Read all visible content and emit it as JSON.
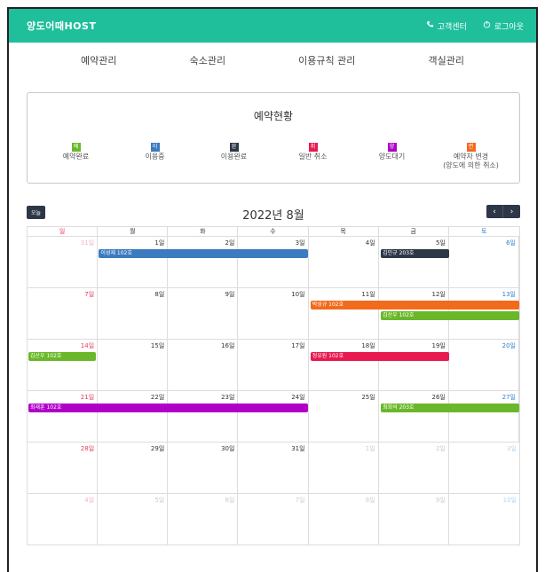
{
  "header": {
    "logo": "양도어때HOST",
    "support": "고객센터",
    "logout": "로그아웃"
  },
  "nav": [
    "예약관리",
    "숙소관리",
    "이용규칙 관리",
    "객실관리"
  ],
  "status": {
    "title": "예약현황",
    "legend": [
      {
        "badge": "예",
        "label": "예약완료",
        "color": "#6ab82a"
      },
      {
        "badge": "이",
        "label": "이용중",
        "color": "#3b7bbf"
      },
      {
        "badge": "완",
        "label": "이용완료",
        "color": "#2d3748"
      },
      {
        "badge": "취",
        "label": "일반 취소",
        "color": "#e8194f"
      },
      {
        "badge": "양",
        "label": "양도대기",
        "color": "#b000c8"
      },
      {
        "badge": "변",
        "label": "예약자 변경\n(양도에 의한 취소)",
        "color": "#f26a1b"
      }
    ]
  },
  "calendar": {
    "today_label": "오늘",
    "title": "2022년 8월",
    "prev": "‹",
    "next": "›",
    "weekdays": [
      "일",
      "월",
      "화",
      "수",
      "목",
      "금",
      "토"
    ],
    "weeks": [
      {
        "days": [
          "31일",
          "1일",
          "2일",
          "3일",
          "4일",
          "5일",
          "6일"
        ],
        "other": [
          0
        ],
        "events": [
          {
            "label": "이성재 102호",
            "start": 1,
            "span": 3,
            "row": 0,
            "color": "#3b7bbf"
          },
          {
            "label": "김민규 203호",
            "start": 5,
            "span": 1,
            "row": 0,
            "color": "#2d3748"
          }
        ]
      },
      {
        "days": [
          "7일",
          "8일",
          "9일",
          "10일",
          "11일",
          "12일",
          "13일"
        ],
        "other": [],
        "events": [
          {
            "label": "박성규 102호",
            "start": 4,
            "span": 3,
            "row": 0,
            "color": "#f26a1b"
          },
          {
            "label": "김산우 102호",
            "start": 5,
            "span": 2,
            "row": 1,
            "color": "#6ab82a"
          }
        ]
      },
      {
        "days": [
          "14일",
          "15일",
          "16일",
          "17일",
          "18일",
          "19일",
          "20일"
        ],
        "other": [],
        "events": [
          {
            "label": "김산우 102호",
            "start": 0,
            "span": 1,
            "row": 0,
            "color": "#6ab82a"
          },
          {
            "label": "정유원 102호",
            "start": 4,
            "span": 2,
            "row": 0,
            "color": "#e8194f"
          }
        ]
      },
      {
        "days": [
          "21일",
          "22일",
          "23일",
          "24일",
          "25일",
          "26일",
          "27일"
        ],
        "other": [],
        "events": [
          {
            "label": "최재훈 102호",
            "start": 0,
            "span": 4,
            "row": 0,
            "color": "#b000c8"
          },
          {
            "label": "최희석 203호",
            "start": 5,
            "span": 2,
            "row": 0,
            "color": "#6ab82a"
          }
        ]
      },
      {
        "days": [
          "28일",
          "29일",
          "30일",
          "31일",
          "1일",
          "2일",
          "3일"
        ],
        "other": [
          4,
          5,
          6
        ],
        "events": []
      },
      {
        "days": [
          "4일",
          "5일",
          "6일",
          "7일",
          "8일",
          "9일",
          "10일"
        ],
        "other": [
          0,
          1,
          2,
          3,
          4,
          5,
          6
        ],
        "events": []
      }
    ]
  }
}
